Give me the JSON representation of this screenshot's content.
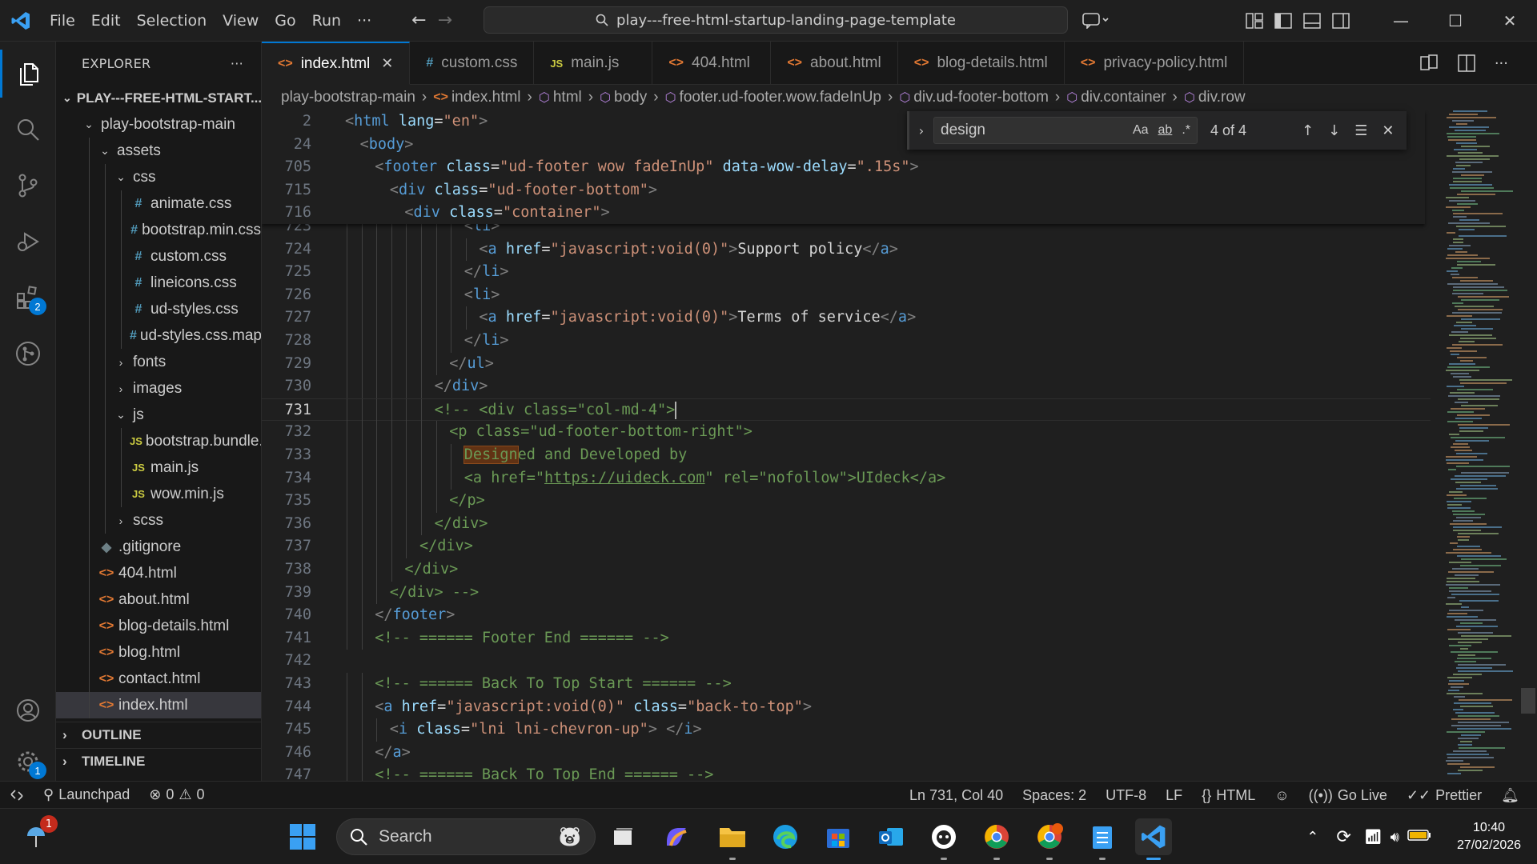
{
  "menu": [
    "File",
    "Edit",
    "Selection",
    "View",
    "Go",
    "Run",
    "···"
  ],
  "command_center": "play---free-html-startup-landing-page-template",
  "explorer": {
    "title": "EXPLORER",
    "more": "···",
    "root": "PLAY---FREE-HTML-START...",
    "items": [
      {
        "label": "play-bootstrap-main",
        "kind": "folder-open",
        "depth": 1
      },
      {
        "label": "assets",
        "kind": "folder-open",
        "depth": 2
      },
      {
        "label": "css",
        "kind": "folder-open",
        "depth": 3
      },
      {
        "label": "animate.css",
        "kind": "css",
        "depth": 4
      },
      {
        "label": "bootstrap.min.css",
        "kind": "css",
        "depth": 4
      },
      {
        "label": "custom.css",
        "kind": "css",
        "depth": 4
      },
      {
        "label": "lineicons.css",
        "kind": "css",
        "depth": 4
      },
      {
        "label": "ud-styles.css",
        "kind": "css",
        "depth": 4
      },
      {
        "label": "ud-styles.css.map",
        "kind": "css",
        "depth": 4
      },
      {
        "label": "fonts",
        "kind": "folder",
        "depth": 3
      },
      {
        "label": "images",
        "kind": "folder",
        "depth": 3
      },
      {
        "label": "js",
        "kind": "folder-open",
        "depth": 3
      },
      {
        "label": "bootstrap.bundle....",
        "kind": "js",
        "depth": 4
      },
      {
        "label": "main.js",
        "kind": "js",
        "depth": 4
      },
      {
        "label": "wow.min.js",
        "kind": "js",
        "depth": 4
      },
      {
        "label": "scss",
        "kind": "folder",
        "depth": 3
      },
      {
        "label": ".gitignore",
        "kind": "git",
        "depth": 2
      },
      {
        "label": "404.html",
        "kind": "html",
        "depth": 2
      },
      {
        "label": "about.html",
        "kind": "html",
        "depth": 2
      },
      {
        "label": "blog-details.html",
        "kind": "html",
        "depth": 2
      },
      {
        "label": "blog.html",
        "kind": "html",
        "depth": 2
      },
      {
        "label": "contact.html",
        "kind": "html",
        "depth": 2
      },
      {
        "label": "index.html",
        "kind": "html",
        "depth": 2,
        "selected": true
      }
    ],
    "outline": "OUTLINE",
    "timeline": "TIMELINE"
  },
  "tabs": [
    {
      "label": "index.html",
      "icon": "<>",
      "active": true
    },
    {
      "label": "custom.css",
      "icon": "#"
    },
    {
      "label": "main.js",
      "icon": "JS"
    },
    {
      "label": "404.html",
      "icon": "<>"
    },
    {
      "label": "about.html",
      "icon": "<>"
    },
    {
      "label": "blog-details.html",
      "icon": "<>"
    },
    {
      "label": "privacy-policy.html",
      "icon": "<>"
    }
  ],
  "breadcrumb": [
    "play-bootstrap-main",
    "index.html",
    "html",
    "body",
    "footer.ud-footer.wow.fadeInUp",
    "div.ud-footer-bottom",
    "div.container",
    "div.row"
  ],
  "find": {
    "query": "design",
    "case_label": "Aa",
    "word_label": "ab",
    "regex_label": ".*",
    "count": "4 of 4"
  },
  "sticky_lines": [
    {
      "n": "2",
      "html": "<span class='p'>&lt;</span><span class='t'>html</span> <span class='a'>lang</span><span class='x'>=</span><span class='s'>\"en\"</span><span class='p'>&gt;</span>",
      "indent": 0
    },
    {
      "n": "24",
      "html": "<span class='p'>&lt;</span><span class='t'>body</span><span class='p'>&gt;</span>",
      "indent": 1
    },
    {
      "n": "705",
      "html": "<span class='p'>&lt;</span><span class='t'>footer</span> <span class='a'>class</span><span class='x'>=</span><span class='s'>\"ud-footer wow fadeInUp\"</span> <span class='a'>data-wow-delay</span><span class='x'>=</span><span class='s'>\".15s\"</span><span class='p'>&gt;</span>",
      "indent": 2
    },
    {
      "n": "715",
      "html": "<span class='p'>&lt;</span><span class='t'>div</span> <span class='a'>class</span><span class='x'>=</span><span class='s'>\"ud-footer-bottom\"</span><span class='p'>&gt;</span>",
      "indent": 3
    },
    {
      "n": "716",
      "html": "<span class='p'>&lt;</span><span class='t'>div</span> <span class='a'>class</span><span class='x'>=</span><span class='s'>\"container\"</span><span class='p'>&gt;</span>",
      "indent": 4
    }
  ],
  "code_lines": [
    {
      "n": "723",
      "html": "<span class='p'>&lt;</span><span class='t'>li</span><span class='p'>&gt;</span>",
      "indent": 8
    },
    {
      "n": "724",
      "html": "<span class='p'>&lt;</span><span class='t'>a</span> <span class='a'>href</span><span class='x'>=</span><span class='s'>\"javascript:void(0)\"</span><span class='p'>&gt;</span><span class='x'>Support policy</span><span class='p'>&lt;/</span><span class='t'>a</span><span class='p'>&gt;</span>",
      "indent": 9
    },
    {
      "n": "725",
      "html": "<span class='p'>&lt;/</span><span class='t'>li</span><span class='p'>&gt;</span>",
      "indent": 8
    },
    {
      "n": "726",
      "html": "<span class='p'>&lt;</span><span class='t'>li</span><span class='p'>&gt;</span>",
      "indent": 8
    },
    {
      "n": "727",
      "html": "<span class='p'>&lt;</span><span class='t'>a</span> <span class='a'>href</span><span class='x'>=</span><span class='s'>\"javascript:void(0)\"</span><span class='p'>&gt;</span><span class='x'>Terms of service</span><span class='p'>&lt;/</span><span class='t'>a</span><span class='p'>&gt;</span>",
      "indent": 9
    },
    {
      "n": "728",
      "html": "<span class='p'>&lt;/</span><span class='t'>li</span><span class='p'>&gt;</span>",
      "indent": 8
    },
    {
      "n": "729",
      "html": "<span class='p'>&lt;/</span><span class='t'>ul</span><span class='p'>&gt;</span>",
      "indent": 7
    },
    {
      "n": "730",
      "html": "<span class='p'>&lt;/</span><span class='t'>div</span><span class='p'>&gt;</span>",
      "indent": 6
    },
    {
      "n": "731",
      "html": "<span class='c'>&lt;!-- &lt;div class=\"col-md-4\"&gt;</span><span class='cursor'></span>",
      "indent": 6,
      "current": true
    },
    {
      "n": "732",
      "html": "<span class='c'>&lt;p class=\"ud-footer-bottom-right\"&gt;</span>",
      "indent": 7
    },
    {
      "n": "733",
      "html": "<span class='c'><span class='findhl'>Design</span>ed and Developed by</span>",
      "indent": 8
    },
    {
      "n": "734",
      "html": "<span class='c'>&lt;a href=\"<span class='uline'>https://uideck.com</span>\" rel=\"nofollow\"&gt;UIdeck&lt;/a&gt;</span>",
      "indent": 8
    },
    {
      "n": "735",
      "html": "<span class='c'>&lt;/p&gt;</span>",
      "indent": 7
    },
    {
      "n": "736",
      "html": "<span class='c'>&lt;/div&gt;</span>",
      "indent": 6
    },
    {
      "n": "737",
      "html": "<span class='c'>&lt;/div&gt;</span>",
      "indent": 5
    },
    {
      "n": "738",
      "html": "<span class='c'>&lt;/div&gt;</span>",
      "indent": 4
    },
    {
      "n": "739",
      "html": "<span class='c'>&lt;/div&gt; --&gt;</span>",
      "indent": 3
    },
    {
      "n": "740",
      "html": "<span class='p'>&lt;/</span><span class='t'>footer</span><span class='p'>&gt;</span>",
      "indent": 2
    },
    {
      "n": "741",
      "html": "<span class='c'>&lt;!-- ====== Footer End ====== --&gt;</span>",
      "indent": 2
    },
    {
      "n": "742",
      "html": "",
      "indent": 0
    },
    {
      "n": "743",
      "html": "<span class='c'>&lt;!-- ====== Back To Top Start ====== --&gt;</span>",
      "indent": 2
    },
    {
      "n": "744",
      "html": "<span class='p'>&lt;</span><span class='t'>a</span> <span class='a'>href</span><span class='x'>=</span><span class='s'>\"javascript:void(0)\"</span> <span class='a'>class</span><span class='x'>=</span><span class='s'>\"back-to-top\"</span><span class='p'>&gt;</span>",
      "indent": 2
    },
    {
      "n": "745",
      "html": "<span class='p'>&lt;</span><span class='t'>i</span> <span class='a'>class</span><span class='x'>=</span><span class='s'>\"lni lni-chevron-up\"</span><span class='p'>&gt;</span> <span class='p'>&lt;/</span><span class='t'>i</span><span class='p'>&gt;</span>",
      "indent": 3
    },
    {
      "n": "746",
      "html": "<span class='p'>&lt;/</span><span class='t'>a</span><span class='p'>&gt;</span>",
      "indent": 2
    },
    {
      "n": "747",
      "html": "<span class='c'>&lt;!-- ====== Back To Top End ====== --&gt;</span>",
      "indent": 2
    }
  ],
  "status": {
    "launchpad": "Launchpad",
    "errors": "0",
    "warnings": "0",
    "position": "Ln 731, Col 40",
    "spaces": "Spaces: 2",
    "encoding": "UTF-8",
    "eol": "LF",
    "language": "HTML",
    "golive": "Go Live",
    "prettier": "Prettier"
  },
  "taskbar": {
    "search_placeholder": "Search",
    "time": "10:40",
    "date": "27/02/2026",
    "weather_badge": "1",
    "extensions_badge": "2",
    "settings_badge": "1"
  },
  "colors": {
    "accent": "#0078d4",
    "editor_bg": "#1f1f1f",
    "sidebar_bg": "#181818"
  }
}
